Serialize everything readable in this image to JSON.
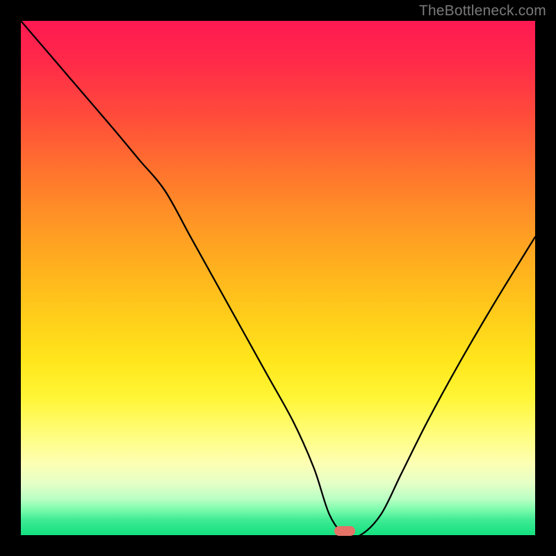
{
  "watermark": "TheBottleneck.com",
  "marker": {
    "x_pct": 63,
    "y_pct": 99.2,
    "color": "#e57368"
  },
  "chart_data": {
    "type": "line",
    "title": "",
    "xlabel": "",
    "ylabel": "",
    "xlim": [
      0,
      100
    ],
    "ylim": [
      0,
      100
    ],
    "grid": false,
    "legend": false,
    "background": "rainbow-gradient (red top → green bottom)",
    "series": [
      {
        "name": "bottleneck-curve",
        "x": [
          0,
          6,
          12,
          18,
          23,
          28,
          33,
          38,
          43,
          48,
          53,
          57,
          60,
          63,
          66,
          70,
          74,
          79,
          85,
          92,
          100
        ],
        "y": [
          100,
          93,
          86,
          79,
          73,
          67,
          58,
          49,
          40,
          31,
          22,
          13,
          4,
          0,
          0,
          4,
          12,
          22,
          33,
          45,
          58
        ]
      }
    ],
    "annotations": [
      {
        "type": "pill-marker",
        "x": 63,
        "y": 0,
        "color": "#e57368"
      }
    ]
  }
}
